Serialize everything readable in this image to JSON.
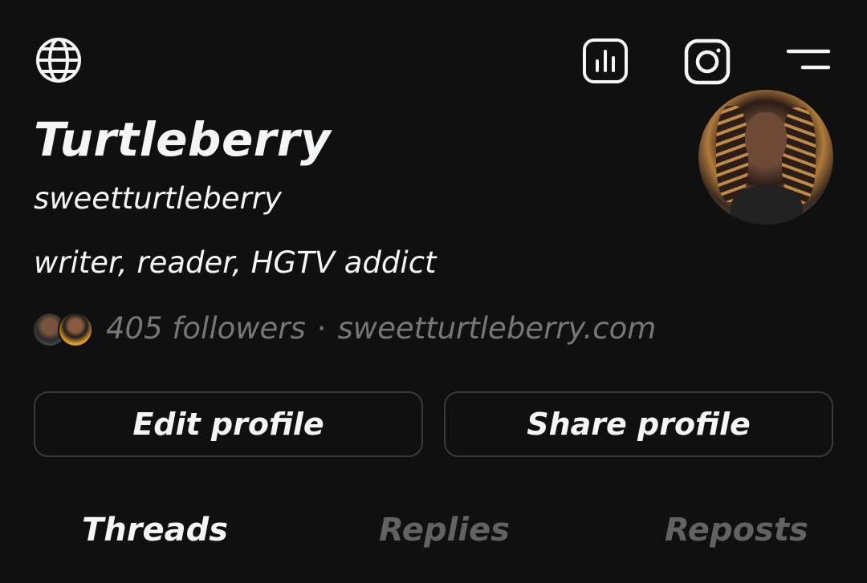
{
  "header": {
    "icons": [
      "globe-icon",
      "insights-icon",
      "instagram-icon",
      "menu-icon"
    ]
  },
  "profile": {
    "display_name": "Turtleberry",
    "username": "sweetturtleberry",
    "bio": "writer, reader, HGTV addict",
    "followers_text": "405 followers",
    "separator": "·",
    "link": "sweetturtleberry.com"
  },
  "actions": {
    "edit_label": "Edit profile",
    "share_label": "Share profile"
  },
  "tabs": [
    {
      "label": "Threads",
      "active": true
    },
    {
      "label": "Replies",
      "active": false
    },
    {
      "label": "Reposts",
      "active": false
    }
  ],
  "colors": {
    "background": "#101010",
    "text": "#f3f5f7",
    "muted": "#777777",
    "border": "#3a3a3a",
    "inactive_tab": "#626262"
  }
}
